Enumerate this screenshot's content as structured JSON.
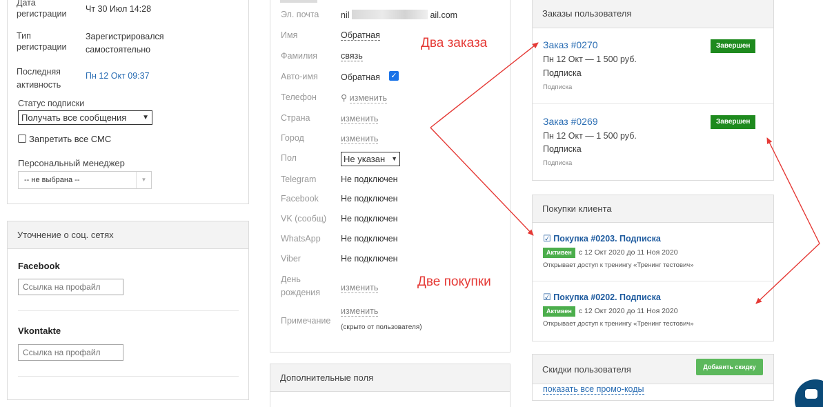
{
  "left": {
    "reg_date_label": "Дата регистрации",
    "reg_date_value": "Чт 30 Июл 14:28",
    "reg_type_label": "Тип регистрации",
    "reg_type_value": "Зарегистрировался самостоятельно",
    "last_active_label": "Последняя активность",
    "last_active_value": "Пн 12 Окт 09:37",
    "sub_status_label": "Статус подписки",
    "sub_status_value": "Получать все сообщения",
    "ban_sms_label": "Запретить все СМС",
    "manager_label": "Персональный менеджер",
    "manager_value": "-- не выбрана --"
  },
  "social": {
    "title": "Уточнение о соц. сетях",
    "facebook_label": "Facebook",
    "facebook_placeholder": "Ссылка на профайл",
    "vk_label": "Vkontakte",
    "vk_placeholder": "Ссылка на профайл"
  },
  "profile": {
    "email_label": "Эл. почта",
    "email_prefix": "nil",
    "email_suffix": "ail.com",
    "first_name_label": "Имя",
    "first_name_value": "Обратная",
    "last_name_label": "Фамилия",
    "last_name_value": "связь",
    "auto_name_label": "Авто-имя",
    "auto_name_value": "Обратная",
    "phone_label": "Телефон",
    "change_link": "изменить",
    "country_label": "Страна",
    "city_label": "Город",
    "gender_label": "Пол",
    "gender_value": "Не указан",
    "telegram_label": "Telegram",
    "facebook_label": "Facebook",
    "vk_label": "VK (сообщ)",
    "whatsapp_label": "WhatsApp",
    "viber_label": "Viber",
    "not_connected": "Не подключен",
    "birthday_label": "День рождения",
    "note_label": "Примечание",
    "note_hint": "(скрыто от пользователя)"
  },
  "extra": {
    "title": "Дополнительные поля"
  },
  "orders": {
    "title": "Заказы пользователя",
    "items": [
      {
        "title": "Заказ #0270",
        "date": "Пн 12 Окт — 1 500 руб.",
        "product": "Подписка",
        "type": "Подписка",
        "status": "Завершен"
      },
      {
        "title": "Заказ #0269",
        "date": "Пн 12 Окт — 1 500 руб.",
        "product": "Подписка",
        "type": "Подписка",
        "status": "Завершен"
      }
    ]
  },
  "purchases": {
    "title": "Покупки клиента",
    "items": [
      {
        "title": "Покупка #0203. Подписка",
        "status": "Активен",
        "period": "с 12 Окт 2020 до 11 Ноя 2020",
        "desc": "Открывает доступ к тренингу «Тренинг тестович»"
      },
      {
        "title": "Покупка #0202. Подписка",
        "status": "Активен",
        "period": "с 12 Окт 2020 до 11 Ноя 2020",
        "desc": "Открывает доступ к тренингу «Тренинг тестович»"
      }
    ]
  },
  "discounts": {
    "title": "Скидки пользователя",
    "add_button": "Добавить скидку",
    "show_promo": "показать все промо-коды"
  },
  "annotations": {
    "two_orders": "Два заказа",
    "two_purchases": "Две покупки"
  },
  "colors": {
    "accent_link": "#2a6db3",
    "done_badge": "#1e8a1e",
    "active_badge": "#4cae4c",
    "annotation": "#e53935"
  }
}
